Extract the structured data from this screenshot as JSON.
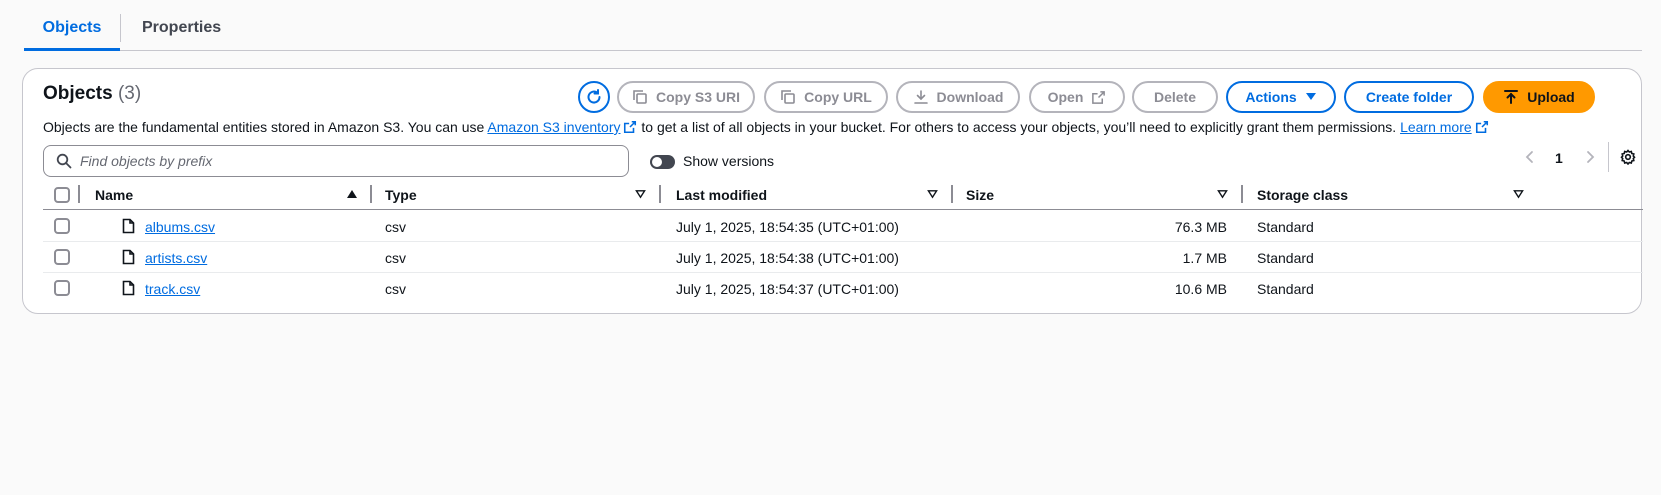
{
  "tabs": [
    {
      "label": "Objects",
      "active": true
    },
    {
      "label": "Properties",
      "active": false
    }
  ],
  "panel": {
    "title": "Objects",
    "count": "(3)",
    "buttons": {
      "refresh": "refresh-icon",
      "copy_s3_uri": "Copy S3 URI",
      "copy_url": "Copy URL",
      "download": "Download",
      "open": "Open",
      "delete": "Delete",
      "actions": "Actions",
      "create_folder": "Create folder",
      "upload": "Upload"
    },
    "description": {
      "part1": "Objects are the fundamental entities stored in Amazon S3. You can use ",
      "link1": "Amazon S3 inventory",
      "part2": " to get a list of all objects in your bucket. For others to access your objects, you’ll need to explicitly grant them permissions. ",
      "link2": "Learn more"
    },
    "search": {
      "placeholder": "Find objects by prefix",
      "value": ""
    },
    "show_versions": {
      "label": "Show versions",
      "on": false
    },
    "pagination": {
      "current_page": "1"
    }
  },
  "table": {
    "columns": [
      "Name",
      "Type",
      "Last modified",
      "Size",
      "Storage class"
    ],
    "rows": [
      {
        "name": "albums.csv",
        "type": "csv",
        "last_modified": "July 1, 2025, 18:54:35 (UTC+01:00)",
        "size": "76.3 MB",
        "storage_class": "Standard"
      },
      {
        "name": "artists.csv",
        "type": "csv",
        "last_modified": "July 1, 2025, 18:54:38 (UTC+01:00)",
        "size": "1.7 MB",
        "storage_class": "Standard"
      },
      {
        "name": "track.csv",
        "type": "csv",
        "last_modified": "July 1, 2025, 18:54:37 (UTC+01:00)",
        "size": "10.6 MB",
        "storage_class": "Standard"
      }
    ]
  },
  "colors": {
    "link": "#006ce0",
    "upload": "#ff9900",
    "disabled_text": "#8c8c94"
  }
}
